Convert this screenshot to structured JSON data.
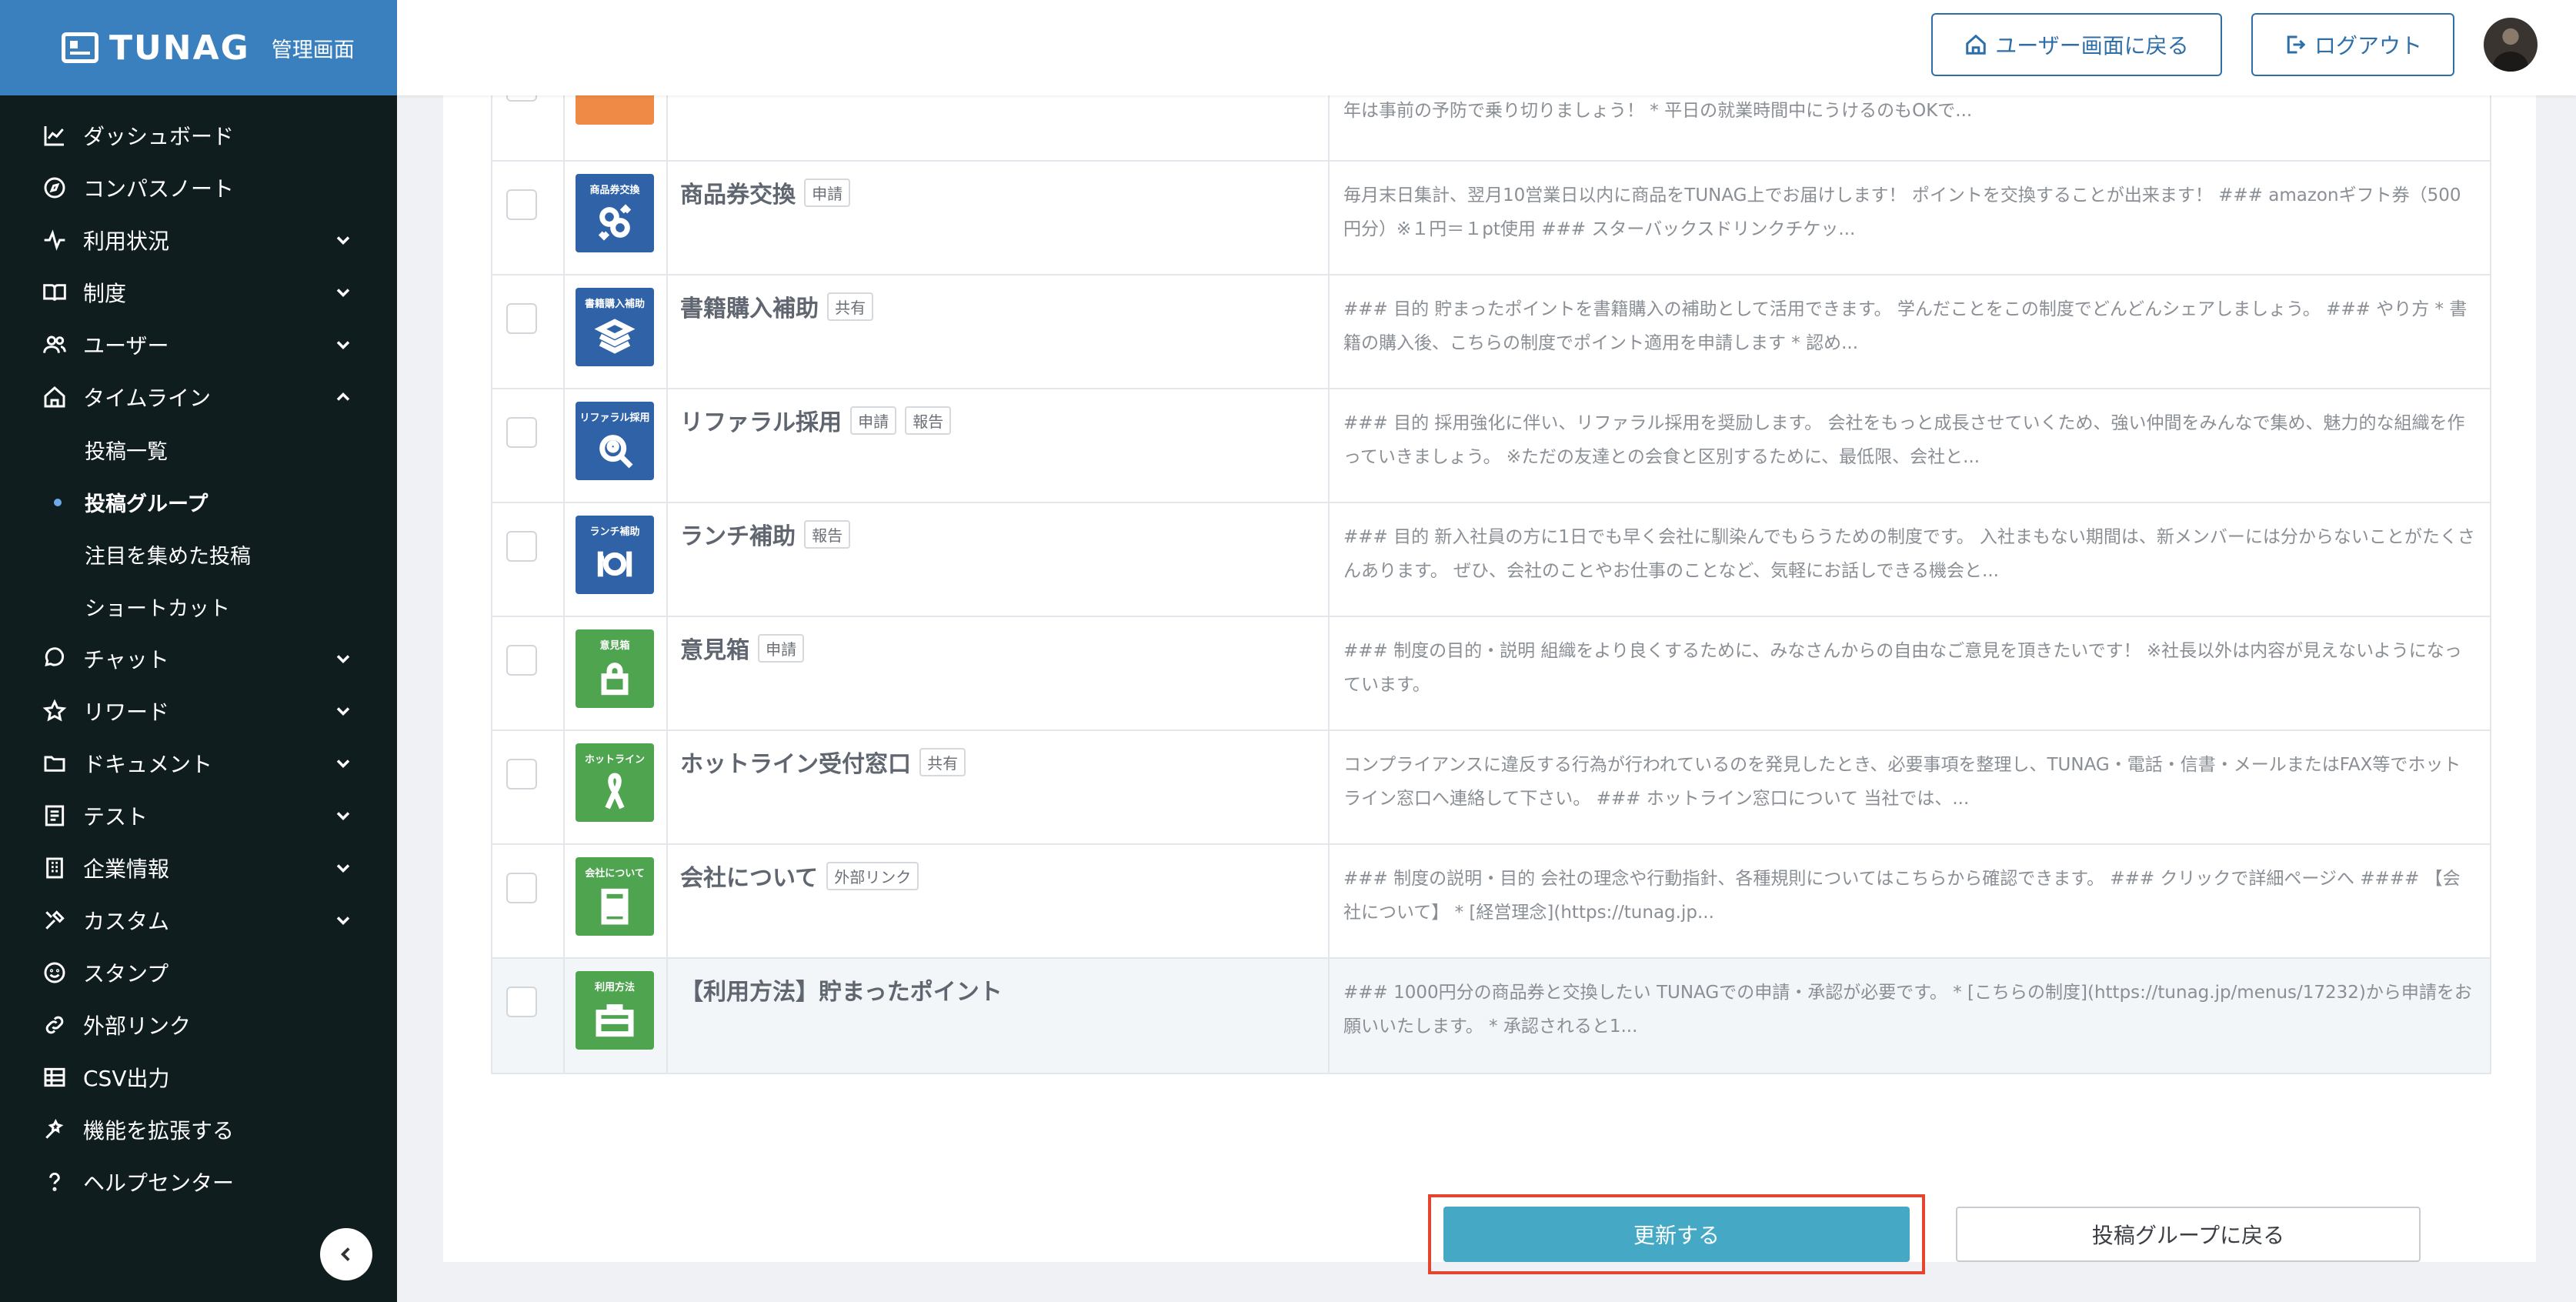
{
  "brand": {
    "logo": "TUNAG",
    "admin_label": "管理画面"
  },
  "header": {
    "back_label": "ユーザー画面に戻る",
    "logout_label": "ログアウト"
  },
  "sidebar": {
    "items": [
      {
        "label": "ダッシュボード",
        "icon": "chart-line-icon"
      },
      {
        "label": "コンパスノート",
        "icon": "compass-icon"
      },
      {
        "label": "利用状況",
        "icon": "pulse-icon",
        "expandable": true
      },
      {
        "label": "制度",
        "icon": "book-icon",
        "expandable": true
      },
      {
        "label": "ユーザー",
        "icon": "users-icon",
        "expandable": true
      },
      {
        "label": "タイムライン",
        "icon": "home-icon",
        "expanded": true
      },
      {
        "label": "チャット",
        "icon": "chat-icon",
        "expandable": true
      },
      {
        "label": "リワード",
        "icon": "star-icon",
        "expandable": true
      },
      {
        "label": "ドキュメント",
        "icon": "folder-icon",
        "expandable": true
      },
      {
        "label": "テスト",
        "icon": "checklist-icon",
        "expandable": true
      },
      {
        "label": "企業情報",
        "icon": "building-icon",
        "expandable": true
      },
      {
        "label": "カスタム",
        "icon": "tools-icon",
        "expandable": true
      },
      {
        "label": "スタンプ",
        "icon": "smile-icon"
      },
      {
        "label": "外部リンク",
        "icon": "link-icon"
      },
      {
        "label": "CSV出力",
        "icon": "table-icon"
      },
      {
        "label": "機能を拡張する",
        "icon": "extension-icon"
      },
      {
        "label": "ヘルプセンター",
        "icon": "help-icon"
      }
    ],
    "timeline_sub": [
      "投稿一覧",
      "投稿グループ",
      "注目を集めた投稿",
      "ショートカット"
    ]
  },
  "rows": [
    {
      "thumb_label": "",
      "thumb_color": "orange",
      "title": "",
      "tags": [],
      "desc": "年は事前の予防で乗り切りましょう！ * 平日の就業時間中にうけるのもOKで..."
    },
    {
      "thumb_label": "商品券交換",
      "thumb_color": "blue",
      "title": "商品券交換",
      "tags": [
        "申請"
      ],
      "desc": "毎月末日集計、翌月10営業日以内に商品をTUNAG上でお届けします！ ポイントを交換することが出来ます！ ### amazonギフト券（500円分）※１円＝１pt使用 ### スターバックスドリンクチケッ..."
    },
    {
      "thumb_label": "書籍購入補助",
      "thumb_color": "blue",
      "title": "書籍購入補助",
      "tags": [
        "共有"
      ],
      "desc": "### 目的 貯まったポイントを書籍購入の補助として活用できます。 学んだことをこの制度でどんどんシェアしましょう。 ### やり方 * 書籍の購入後、こちらの制度でポイント適用を申請します * 認め..."
    },
    {
      "thumb_label": "リファラル採用",
      "thumb_color": "blue",
      "title": "リファラル採用",
      "tags": [
        "申請",
        "報告"
      ],
      "desc": "### 目的 採用強化に伴い、リファラル採用を奨励します。 会社をもっと成長させていくため、強い仲間をみんなで集め、魅力的な組織を作っていきましょう。 ※ただの友達との会食と区別するために、最低限、会社と..."
    },
    {
      "thumb_label": "ランチ補助",
      "thumb_color": "blue",
      "title": "ランチ補助",
      "tags": [
        "報告"
      ],
      "desc": "### 目的 新入社員の方に1日でも早く会社に馴染んでもらうための制度です。 入社まもない期間は、新メンバーには分からないことがたくさんあります。 ぜひ、会社のことやお仕事のことなど、気軽にお話しできる機会と..."
    },
    {
      "thumb_label": "意見箱",
      "thumb_color": "green",
      "title": "意見箱",
      "tags": [
        "申請"
      ],
      "desc": "### 制度の目的・説明 組織をより良くするために、みなさんからの自由なご意見を頂きたいです！ ※社長以外は内容が見えないようになっています。"
    },
    {
      "thumb_label": "ホットライン",
      "thumb_color": "green",
      "title": "ホットライン受付窓口",
      "tags": [
        "共有"
      ],
      "desc": "コンプライアンスに違反する行為が行われているのを発見したとき、必要事項を整理し、TUNAG・電話・信書・メールまたはFAX等でホットライン窓口へ連絡して下さい。 ### ホットライン窓口について 当社では、..."
    },
    {
      "thumb_label": "会社について",
      "thumb_color": "green",
      "title": "会社について",
      "tags": [
        "外部リンク"
      ],
      "desc": "### 制度の説明・目的 会社の理念や行動指針、各種規則についてはこちらから確認できます。 ### クリックで詳細ページへ #### 【会社について】 * [経営理念](https://tunag.jp..."
    },
    {
      "thumb_label": "利用方法",
      "thumb_color": "green",
      "title": "【利用方法】貯まったポイント",
      "tags": [],
      "desc": "### 1000円分の商品券と交換したい TUNAGでの申請・承認が必要です。 * [こちらの制度](https://tunag.jp/menus/17232)から申請をお願いいたします。 * 承認されると1..."
    }
  ],
  "actions": {
    "update_label": "更新する",
    "back_label": "投稿グループに戻る"
  }
}
